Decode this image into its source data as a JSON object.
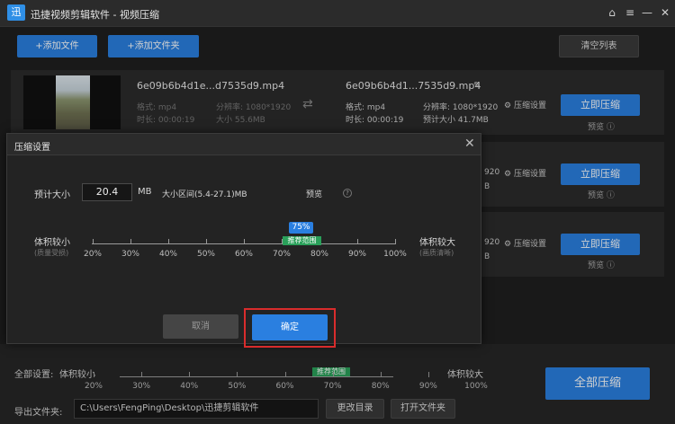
{
  "window": {
    "title": "迅捷视频剪辑软件 - 视频压缩",
    "logo": "迅",
    "controls": [
      "home-icon",
      "menu-icon",
      "minimize-icon",
      "close-icon"
    ]
  },
  "toolbar": {
    "add_file": "+添加文件",
    "add_folder": "+添加文件夹",
    "clear_list": "清空列表"
  },
  "file_row_1": {
    "src_name": "6e09b6b4d1e...d7535d9.mp4",
    "src_format": "格式: mp4",
    "src_res": "分辨率: 1080*1920",
    "src_duration": "时长: 00:00:19",
    "src_size": "大小 55.6MB",
    "out_name": "6e09b6b4d1...7535d9.mp4",
    "out_format": "格式: mp4",
    "out_res": "分辨率: 1080*1920",
    "out_duration": "时长: 00:00:19",
    "out_size": "预计大小 41.7MB",
    "settings": "压缩设置",
    "compress": "立即压缩",
    "preview": "预览"
  },
  "file_row_2": {
    "res_tail": "920",
    "size_tail": "B",
    "settings": "压缩设置",
    "compress": "立即压缩",
    "preview": "预览"
  },
  "file_row_3": {
    "res_tail": "920",
    "size_tail": "B",
    "settings": "压缩设置",
    "compress": "立即压缩",
    "preview": "预览"
  },
  "dialog": {
    "title": "压缩设置",
    "est_size_label": "预计大小",
    "est_size_value": "20.4",
    "unit": "MB",
    "range_text": "大小区间(5.4-27.1)MB",
    "preview": "预览",
    "left_label": "体积较小",
    "left_sub": "(质量受损)",
    "right_label": "体积较大",
    "right_sub": "(画质清晰)",
    "percent_badge": "75%",
    "percent_value": 75,
    "recommend": "推荐范围",
    "ticks": [
      "20%",
      "30%",
      "40%",
      "50%",
      "60%",
      "70%",
      "80%",
      "90%",
      "100%"
    ],
    "cancel": "取消",
    "confirm": "确定"
  },
  "bottom": {
    "all_settings": "全部设置:",
    "left_label": "体积较小",
    "right_label": "体积较大",
    "recommend": "推荐范围",
    "ticks": [
      "20%",
      "30%",
      "40%",
      "50%",
      "60%",
      "70%",
      "80%",
      "90%",
      "100%"
    ],
    "export_label": "导出文件夹:",
    "export_path": "C:\\Users\\FengPing\\Desktop\\迅捷剪辑软件",
    "change_dir": "更改目录",
    "open_folder": "打开文件夹",
    "compress_all": "全部压缩"
  },
  "colors": {
    "accent": "#2a7fe0",
    "recommend": "#2aa05a",
    "highlight": "#d92c2c",
    "background": "#1f1f1f"
  }
}
